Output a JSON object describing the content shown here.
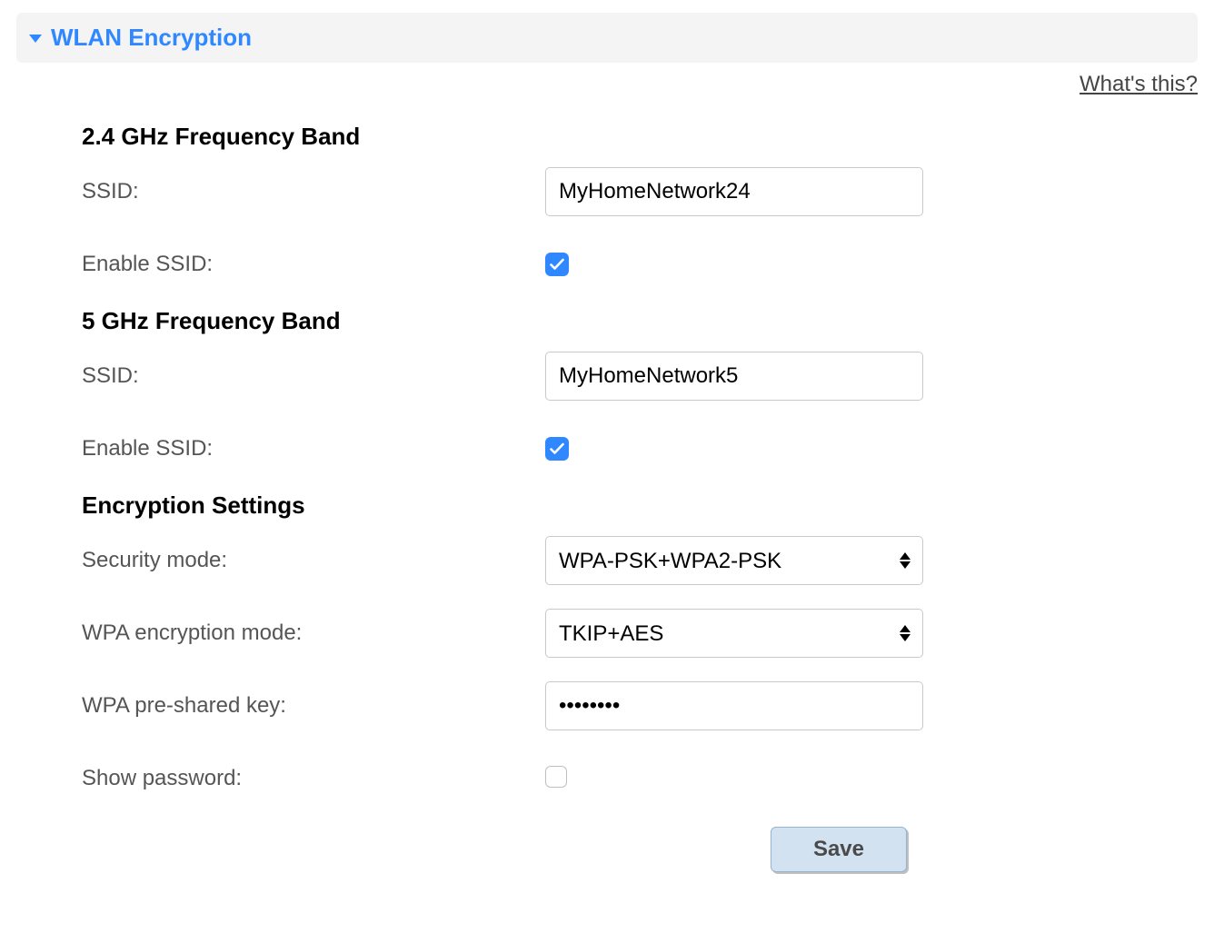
{
  "panel": {
    "title": "WLAN Encryption",
    "help_link": "What's this?"
  },
  "band24": {
    "heading": "2.4 GHz Frequency Band",
    "ssid_label": "SSID:",
    "ssid_value": "MyHomeNetwork24",
    "enable_label": "Enable SSID:",
    "enable_checked": true
  },
  "band5": {
    "heading": "5 GHz Frequency Band",
    "ssid_label": "SSID:",
    "ssid_value": "MyHomeNetwork5",
    "enable_label": "Enable SSID:",
    "enable_checked": true
  },
  "encryption": {
    "heading": "Encryption Settings",
    "security_label": "Security mode:",
    "security_value": "WPA-PSK+WPA2-PSK",
    "wpa_mode_label": "WPA encryption mode:",
    "wpa_mode_value": "TKIP+AES",
    "psk_label": "WPA pre-shared key:",
    "psk_value": "••••••••",
    "show_pw_label": "Show password:",
    "show_pw_checked": false
  },
  "actions": {
    "save_label": "Save"
  }
}
